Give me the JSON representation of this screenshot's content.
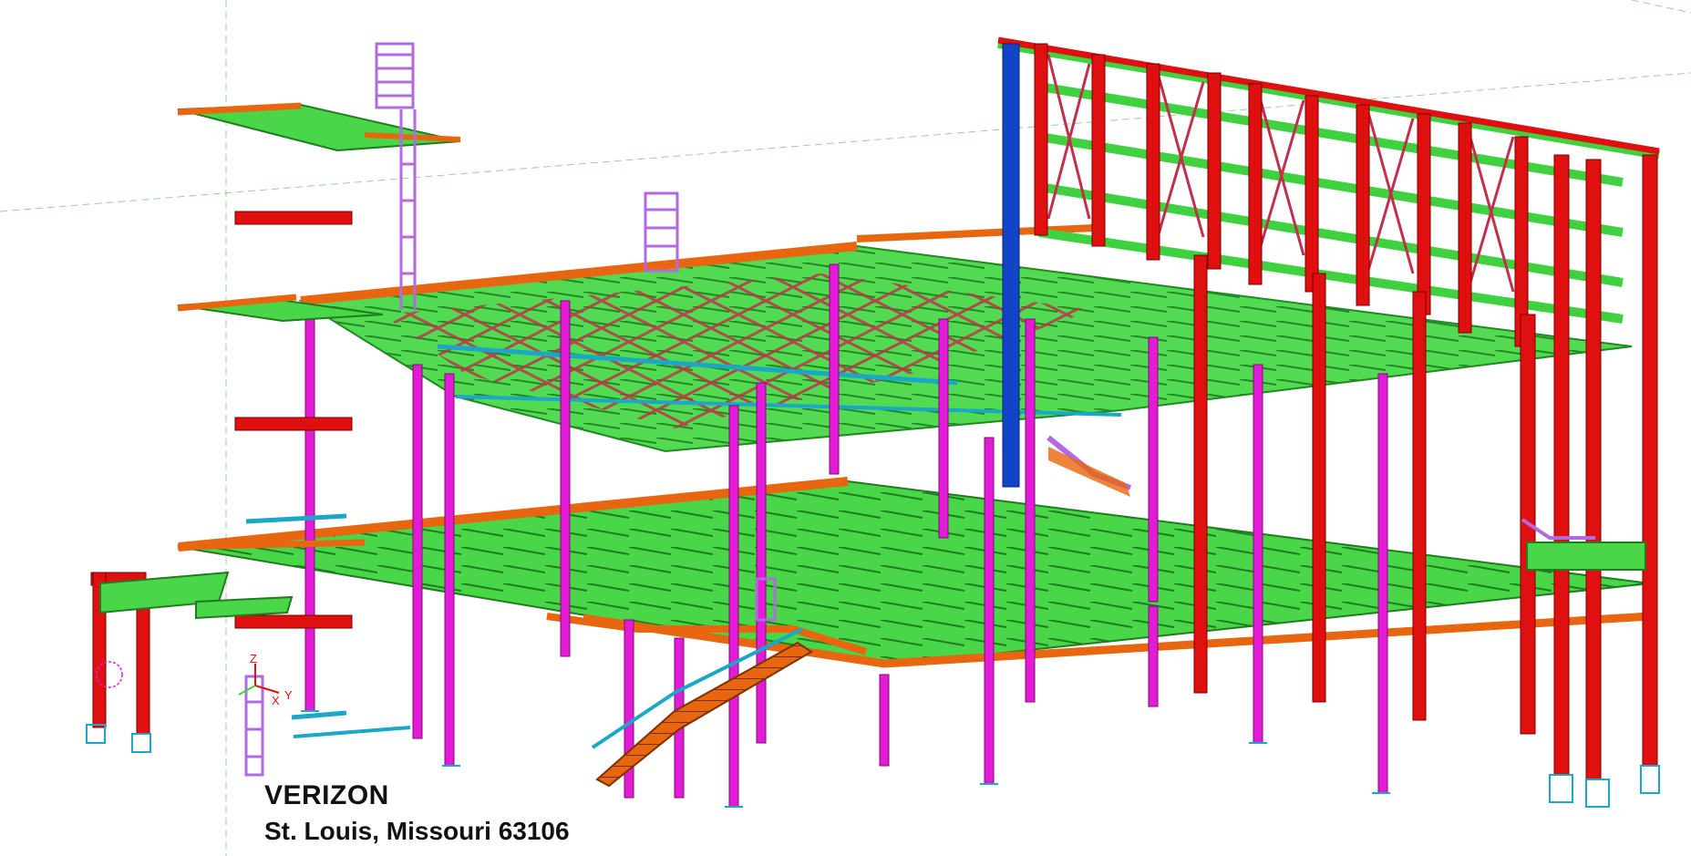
{
  "project": {
    "title": "VERIZON",
    "address": "St. Louis, Missouri 63106"
  },
  "axis_labels": {
    "z": "Z",
    "x": "X",
    "y": "Y"
  },
  "colors": {
    "background": "#ffffff",
    "column": "#e21cd4",
    "frame_column": "#e01010",
    "deck_beam": "#3fd13f",
    "edge_beam": "#e8660f",
    "brace": "#c0304a",
    "tube": "#1aa7c8",
    "blue_column": "#1244c8",
    "stair": "#e8660f",
    "guide_line": "#9bcf9b"
  },
  "icons": {
    "axis": "axis-triad-icon"
  }
}
